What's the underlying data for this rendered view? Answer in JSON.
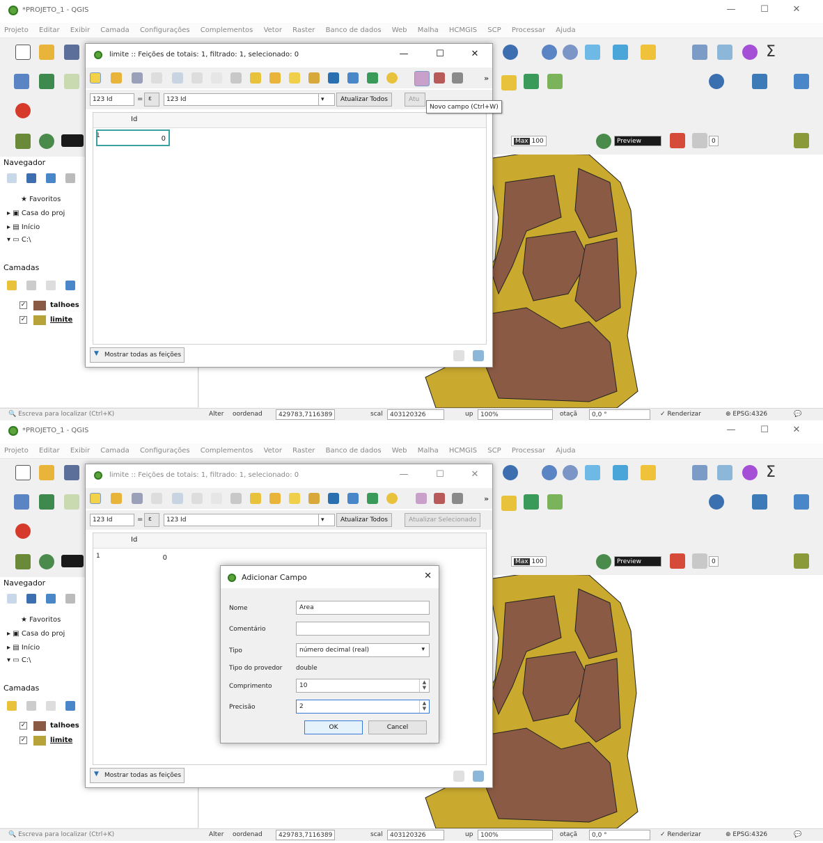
{
  "app": {
    "window_title": "*PROJETO_1 - QGIS",
    "menu": [
      "Projeto",
      "Editar",
      "Exibir",
      "Camada",
      "Configurações",
      "Complementos",
      "Vetor",
      "Raster",
      "Banco de dados",
      "Web",
      "Malha",
      "HCMGIS",
      "SCP",
      "Processar",
      "Ajuda"
    ],
    "sigma_icon": "Σ"
  },
  "left_panel": {
    "navigator_title": "Navegador",
    "tree": [
      "Favoritos",
      "Casa do proj",
      "Início",
      "C:\\"
    ],
    "layers_title": "Camadas",
    "layers": [
      {
        "name": "talhoes",
        "color": "#8b5a44",
        "checked": "✓"
      },
      {
        "name": "limite",
        "color": "#b8a33a",
        "checked": "✓"
      }
    ]
  },
  "toolbar_fields": {
    "max_label": "Max",
    "max_value": "100",
    "preview_label": "Preview",
    "count_value": "0"
  },
  "attribute_table": {
    "title": "limite :: Feições de totais: 1, filtrado: 1, selecionado: 0",
    "field_combo": "123 Id",
    "expression_field": "123 Id",
    "update_all": "Atualizar Todos",
    "update_selected_cut": "Atu",
    "update_selected": "Atualizar Selecionado",
    "column_header": "Id",
    "row_number": "1",
    "cell_value": "0",
    "show_all": "Mostrar todas as feições"
  },
  "tooltip": "Novo campo (Ctrl+W)",
  "add_field_dialog": {
    "title": "Adicionar Campo",
    "name_label": "Nome",
    "name_value": "Area",
    "comment_label": "Comentário",
    "comment_value": "",
    "type_label": "Tipo",
    "type_value": "número decimal (real)",
    "provider_label": "Tipo do provedor",
    "provider_value": "double",
    "length_label": "Comprimento",
    "length_value": "10",
    "precision_label": "Precisão",
    "precision_value": "2",
    "ok": "OK",
    "cancel": "Cancel"
  },
  "status_bar": {
    "search_placeholder": "Escreva para localizar (Ctrl+K)",
    "alter": "Alter",
    "coord_label": "oordenad",
    "coord_value": "429783,7116389",
    "scale_label": "scal",
    "scale_value": "403120326",
    "lupa_label": "up",
    "lupa_value": "100%",
    "rotation_label": "otaçã",
    "rotation_value": "0,0 °",
    "render_label": "Renderizar",
    "crs": "EPSG:4326"
  },
  "colors": {
    "talhoes_fill": "#8b5a44",
    "limite_fill": "#c9a92e"
  }
}
